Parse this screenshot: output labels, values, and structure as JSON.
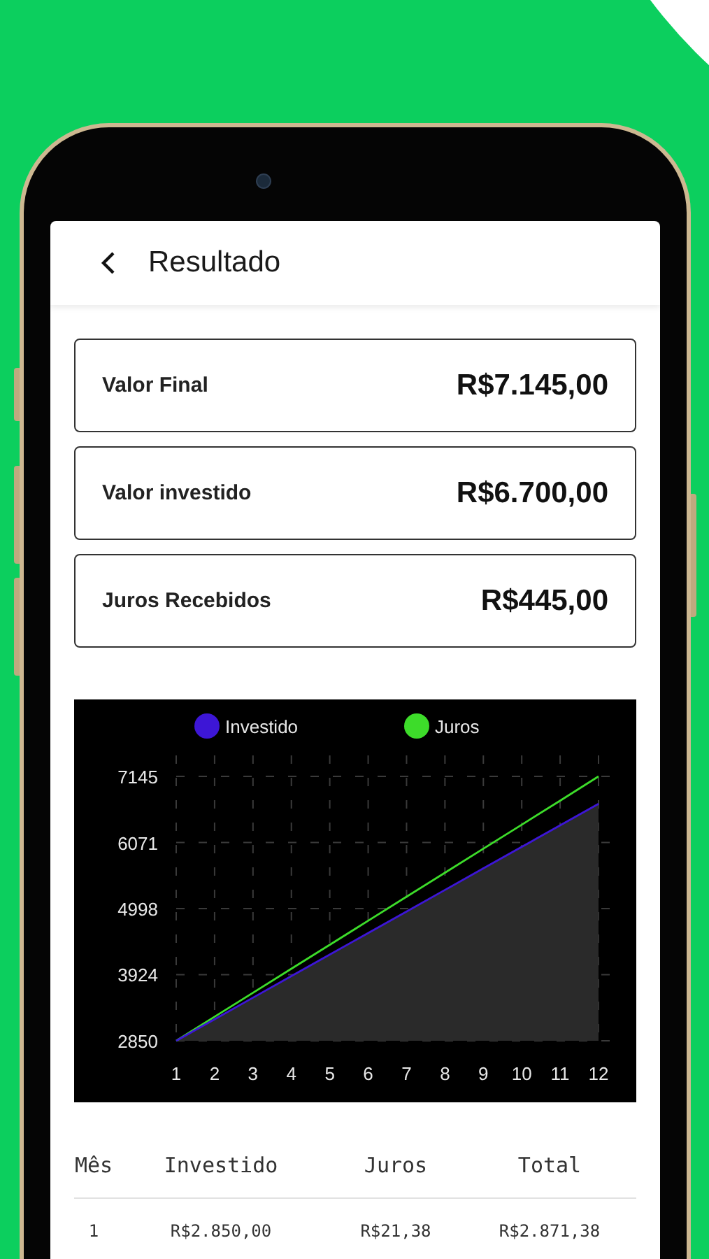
{
  "app_bar": {
    "title": "Resultado"
  },
  "summary": [
    {
      "label": "Valor Final",
      "value": "R$7.145,00"
    },
    {
      "label": "Valor investido",
      "value": "R$6.700,00"
    },
    {
      "label": "Juros Recebidos",
      "value": "R$445,00"
    }
  ],
  "chart": {
    "chart_data": {
      "type": "line",
      "x": [
        1,
        2,
        3,
        4,
        5,
        6,
        7,
        8,
        9,
        10,
        11,
        12
      ],
      "xlim": [
        1,
        12
      ],
      "ylim": [
        2850,
        7145
      ],
      "grid": true,
      "legend": true,
      "yticks": [
        2850,
        3924,
        4998,
        6071,
        7145
      ],
      "xticks": [
        1,
        2,
        3,
        4,
        5,
        6,
        7,
        8,
        9,
        10,
        11,
        12
      ],
      "series": [
        {
          "name": "Investido",
          "color": "#3d16d6",
          "values": [
            2850,
            3200,
            3550,
            3900,
            4250,
            4600,
            4950,
            5300,
            5650,
            6000,
            6350,
            6700
          ]
        },
        {
          "name": "Juros",
          "color": "#3ddc2a",
          "values": [
            2850,
            3240,
            3630,
            4020,
            4410,
            4800,
            5190,
            5580,
            5970,
            6360,
            6750,
            7145
          ]
        }
      ]
    }
  },
  "table": {
    "columns": [
      "Mês",
      "Investido",
      "Juros",
      "Total"
    ],
    "rows": [
      [
        "1",
        "R$2.850,00",
        "R$21,38",
        "R$2.871,38"
      ]
    ]
  }
}
